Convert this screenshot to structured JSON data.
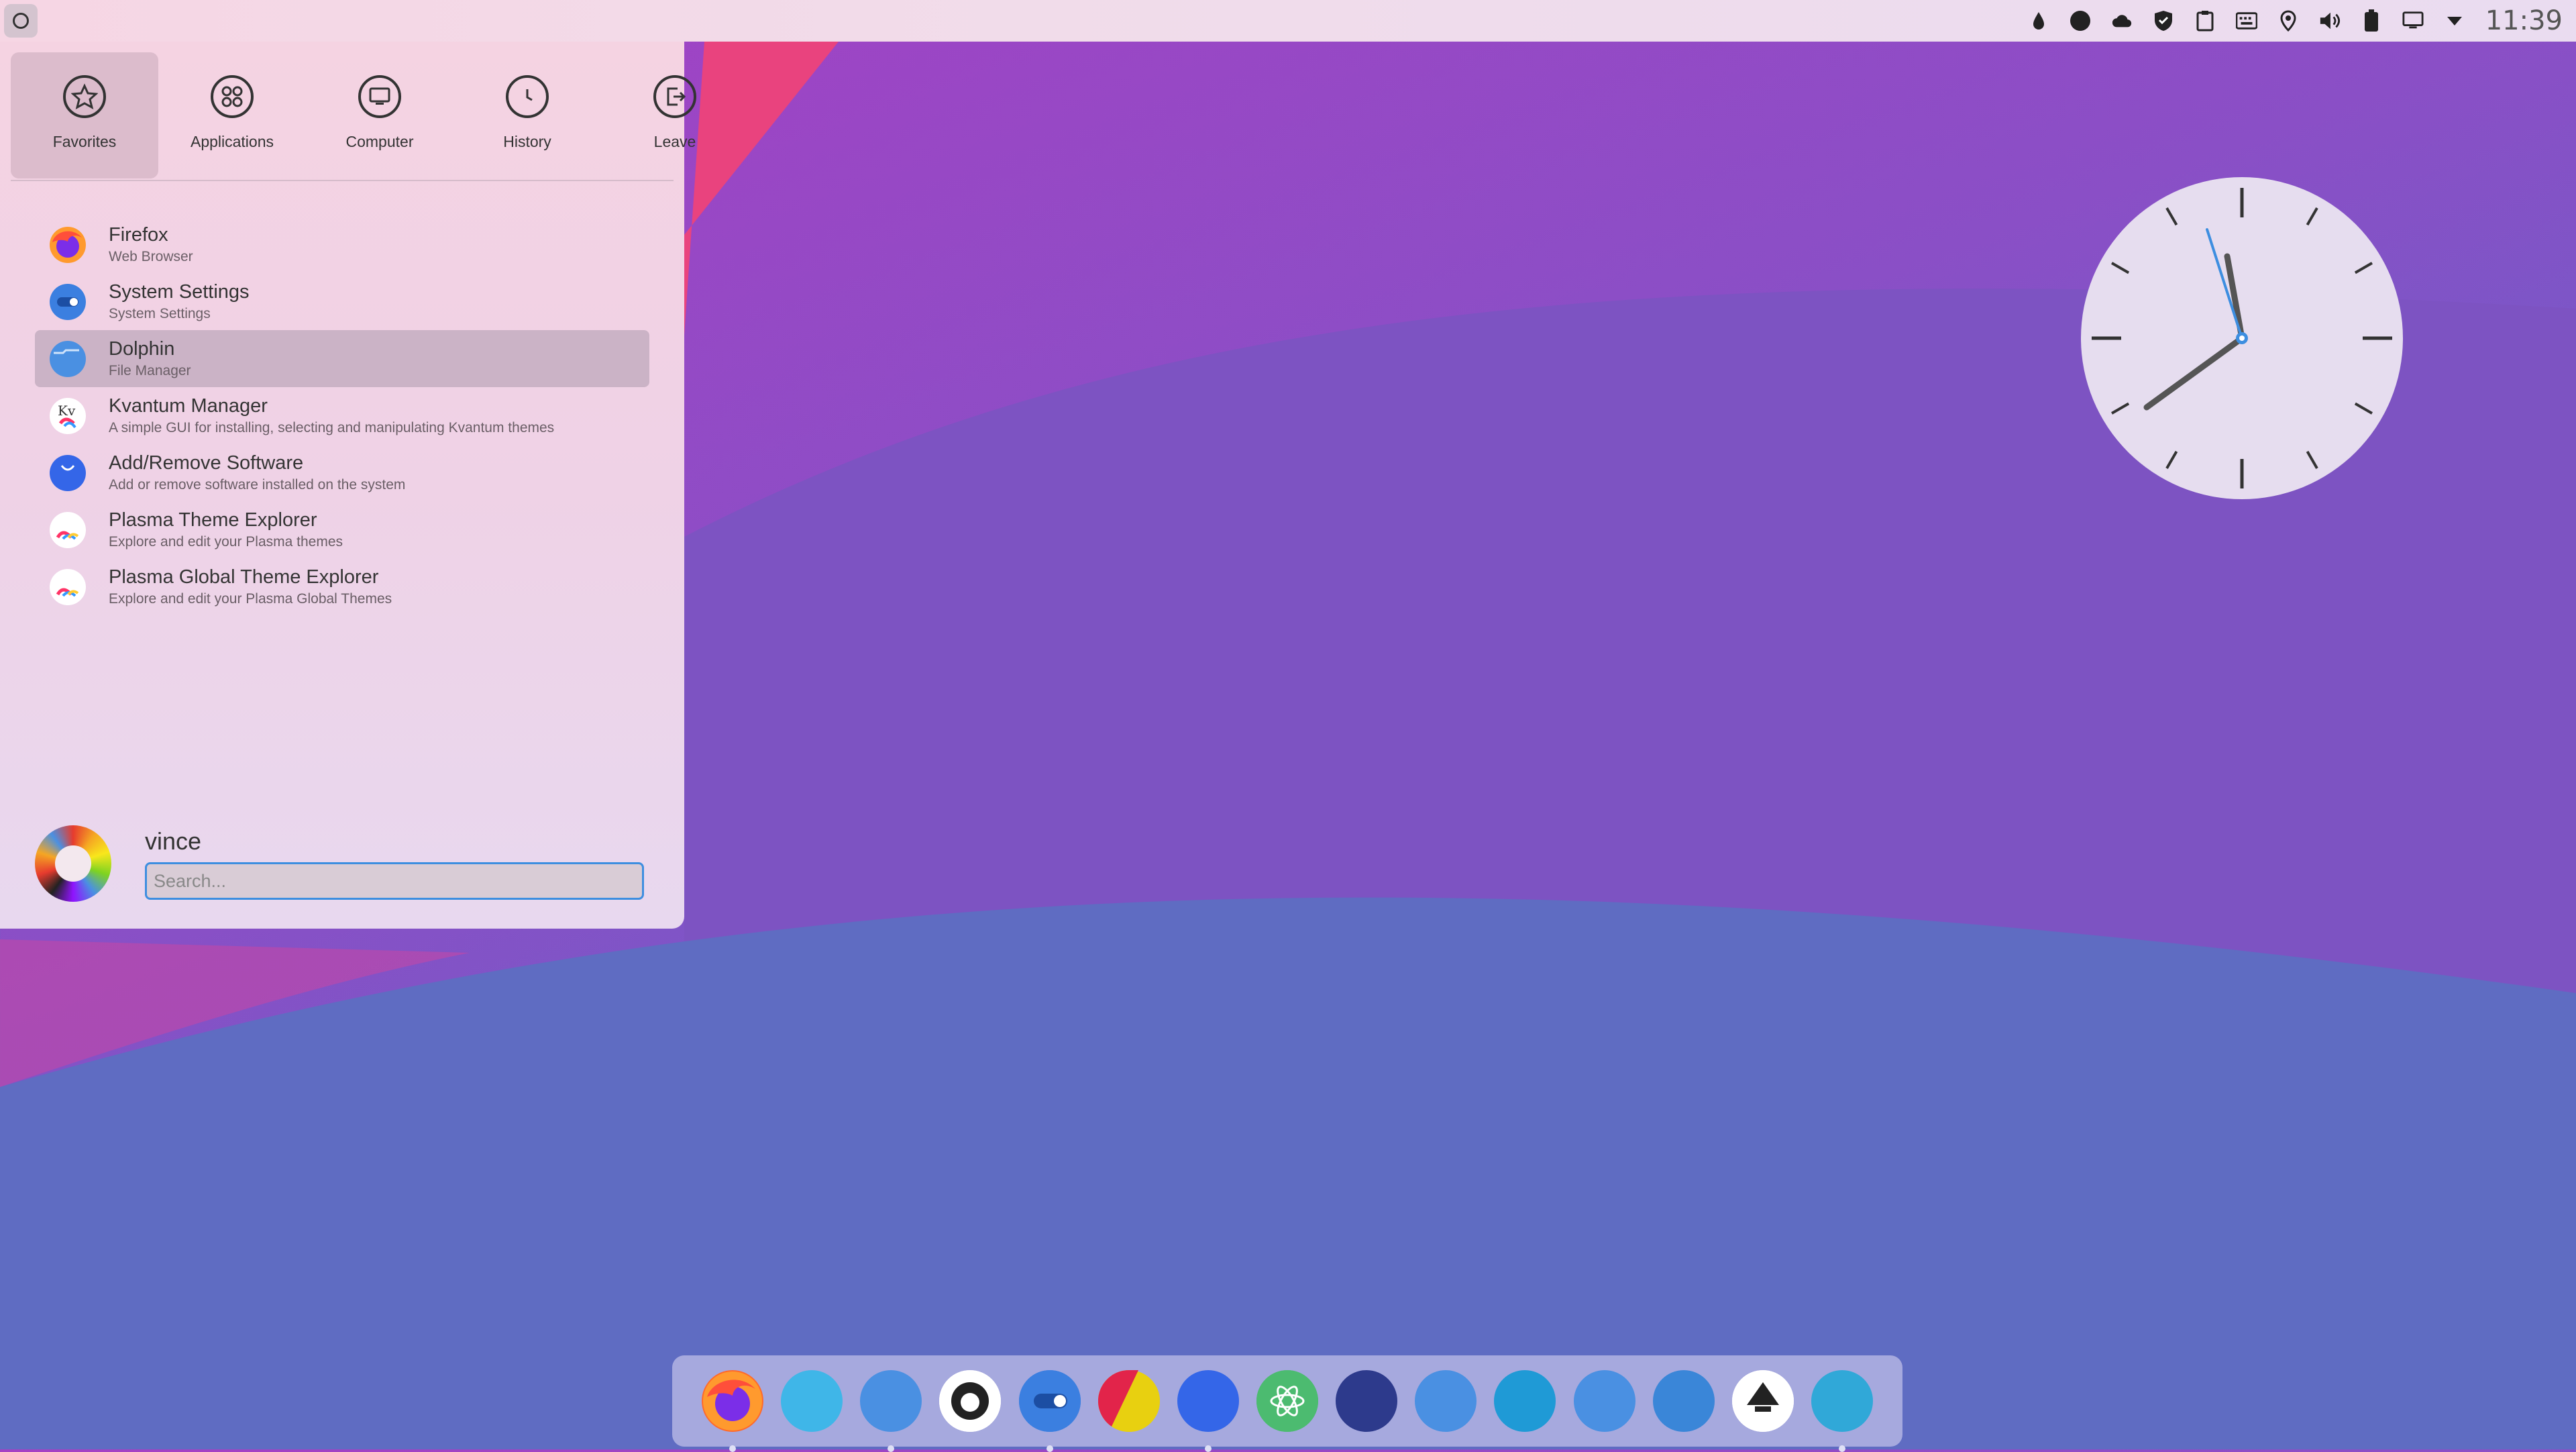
{
  "top_panel": {
    "clock": "11:39",
    "tray_icons": [
      "water-drop-icon",
      "circle-icon",
      "cloud-icon",
      "shield-icon",
      "clipboard-icon",
      "keyboard-icon",
      "location-icon",
      "volume-icon",
      "battery-icon",
      "display-icon",
      "expand-tray-icon"
    ]
  },
  "launcher": {
    "tabs": [
      {
        "label": "Favorites",
        "icon": "star-icon",
        "active": true
      },
      {
        "label": "Applications",
        "icon": "grid-icon",
        "active": false
      },
      {
        "label": "Computer",
        "icon": "monitor-icon",
        "active": false
      },
      {
        "label": "History",
        "icon": "clock-icon",
        "active": false
      },
      {
        "label": "Leave",
        "icon": "logout-icon",
        "active": false
      }
    ],
    "favorites": [
      {
        "name": "Firefox",
        "desc": "Web Browser",
        "color": "#ff6a2b"
      },
      {
        "name": "System Settings",
        "desc": "System Settings",
        "color": "#3b7fe0"
      },
      {
        "name": "Dolphin",
        "desc": "File Manager",
        "color": "#4a90e2"
      },
      {
        "name": "Kvantum Manager",
        "desc": "A simple GUI for installing, selecting and manipulating Kvantum themes",
        "color": "#ffffff"
      },
      {
        "name": "Add/Remove Software",
        "desc": "Add or remove software installed on the system",
        "color": "#3466e8"
      },
      {
        "name": "Plasma Theme Explorer",
        "desc": "Explore and edit your Plasma themes",
        "color": "#ffffff"
      },
      {
        "name": "Plasma Global Theme Explorer",
        "desc": "Explore and edit your Plasma Global Themes",
        "color": "#ffffff"
      }
    ],
    "user": {
      "name": "vince"
    },
    "search": {
      "placeholder": "Search..."
    }
  },
  "dock": {
    "items": [
      {
        "name": "firefox",
        "color": "#ff6a2b",
        "running": true
      },
      {
        "name": "mail",
        "color": "#3fb6e8",
        "running": false
      },
      {
        "name": "files",
        "color": "#4a90e2",
        "running": true
      },
      {
        "name": "github",
        "color": "#ffffff",
        "running": false
      },
      {
        "name": "settings",
        "color": "#3b7fe0",
        "running": true
      },
      {
        "name": "color-app",
        "color": "#e8d010",
        "running": false
      },
      {
        "name": "software",
        "color": "#3466e8",
        "running": true
      },
      {
        "name": "atom",
        "color": "#4cbb70",
        "running": false
      },
      {
        "name": "monitor",
        "color": "#2d3a8c",
        "running": false
      },
      {
        "name": "folder",
        "color": "#4a90e2",
        "running": false
      },
      {
        "name": "mixer",
        "color": "#1f9ad6",
        "running": false
      },
      {
        "name": "folder-2",
        "color": "#4a90e2",
        "running": false
      },
      {
        "name": "store",
        "color": "#3a86d8",
        "running": false
      },
      {
        "name": "inkscape",
        "color": "#ffffff",
        "running": false
      },
      {
        "name": "quotes",
        "color": "#30a8d8",
        "running": true
      }
    ]
  }
}
